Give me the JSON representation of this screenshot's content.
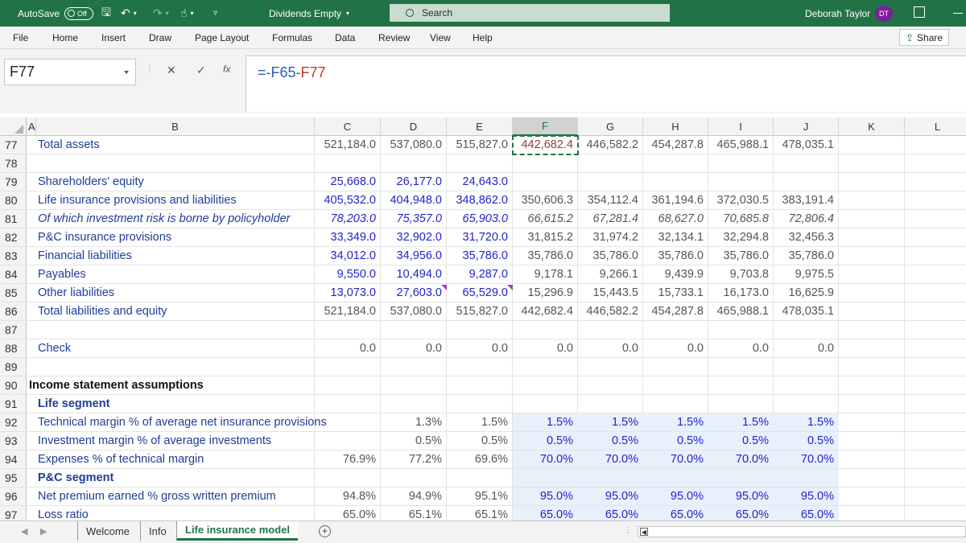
{
  "titlebar": {
    "autosave_label": "AutoSave",
    "autosave_state": "Off",
    "doc_title": "Dividends Empty",
    "search_placeholder": "Search",
    "user_name": "Deborah Taylor",
    "user_initials": "DT",
    "accent_color": "#217346"
  },
  "menu": {
    "items": [
      "File",
      "Home",
      "Insert",
      "Draw",
      "Page Layout",
      "Formulas",
      "Data",
      "Review",
      "View",
      "Help"
    ],
    "share_label": "Share"
  },
  "formula_bar": {
    "name_box": "F77",
    "cancel_symbol": "✕",
    "enter_symbol": "✓",
    "fx_symbol": "fx",
    "formula_prefix": "=-",
    "formula_ref1": "F65",
    "formula_op": "-",
    "formula_ref2": "F77"
  },
  "columns": [
    "A",
    "B",
    "C",
    "D",
    "E",
    "F",
    "G",
    "H",
    "I",
    "J",
    "K",
    "L"
  ],
  "rows": [
    {
      "n": "77",
      "label": "Total assets",
      "style": "normal",
      "values": [
        "521,184.0",
        "537,080.0",
        "515,827.0",
        "442,682.4",
        "446,582.2",
        "454,287.8",
        "465,988.1",
        "478,035.1"
      ],
      "colors": [
        "gray",
        "gray",
        "gray",
        "gray",
        "gray",
        "gray",
        "gray",
        "gray"
      ]
    },
    {
      "n": "78",
      "label": "",
      "style": "normal",
      "values": [],
      "colors": []
    },
    {
      "n": "79",
      "label": "Shareholders' equity",
      "style": "normal",
      "values": [
        "25,668.0",
        "26,177.0",
        "24,643.0"
      ],
      "colors": [
        "blue",
        "blue",
        "blue"
      ]
    },
    {
      "n": "80",
      "label": "Life insurance provisions and liabilities",
      "style": "normal",
      "values": [
        "405,532.0",
        "404,948.0",
        "348,862.0",
        "350,606.3",
        "354,112.4",
        "361,194.6",
        "372,030.5",
        "383,191.4"
      ],
      "colors": [
        "blue",
        "blue",
        "blue",
        "gray",
        "gray",
        "gray",
        "gray",
        "gray"
      ]
    },
    {
      "n": "81",
      "label": "Of which investment risk is borne by policyholder",
      "style": "italic",
      "values": [
        "78,203.0",
        "75,357.0",
        "65,903.0",
        "66,615.2",
        "67,281.4",
        "68,627.0",
        "70,685.8",
        "72,806.4"
      ],
      "colors": [
        "blue",
        "blue",
        "blue",
        "gray",
        "gray",
        "gray",
        "gray",
        "gray"
      ]
    },
    {
      "n": "82",
      "label": "P&C insurance provisions",
      "style": "normal",
      "values": [
        "33,349.0",
        "32,902.0",
        "31,720.0",
        "31,815.2",
        "31,974.2",
        "32,134.1",
        "32,294.8",
        "32,456.3"
      ],
      "colors": [
        "blue",
        "blue",
        "blue",
        "gray",
        "gray",
        "gray",
        "gray",
        "gray"
      ]
    },
    {
      "n": "83",
      "label": "Financial liabilities",
      "style": "normal",
      "values": [
        "34,012.0",
        "34,956.0",
        "35,786.0",
        "35,786.0",
        "35,786.0",
        "35,786.0",
        "35,786.0",
        "35,786.0"
      ],
      "colors": [
        "blue",
        "blue",
        "blue",
        "gray",
        "gray",
        "gray",
        "gray",
        "gray"
      ]
    },
    {
      "n": "84",
      "label": "Payables",
      "style": "normal",
      "values": [
        "9,550.0",
        "10,494.0",
        "9,287.0",
        "9,178.1",
        "9,266.1",
        "9,439.9",
        "9,703.8",
        "9,975.5"
      ],
      "colors": [
        "blue",
        "blue",
        "blue",
        "gray",
        "gray",
        "gray",
        "gray",
        "gray"
      ]
    },
    {
      "n": "85",
      "label": "Other liabilities",
      "style": "normal",
      "values": [
        "13,073.0",
        "27,603.0",
        "65,529.0",
        "15,296.9",
        "15,443.5",
        "15,733.1",
        "16,173.0",
        "16,625.9"
      ],
      "colors": [
        "blue",
        "blue",
        "blue",
        "gray",
        "gray",
        "gray",
        "gray",
        "gray"
      ]
    },
    {
      "n": "86",
      "label": "Total liabilities and equity",
      "style": "normal",
      "values": [
        "521,184.0",
        "537,080.0",
        "515,827.0",
        "442,682.4",
        "446,582.2",
        "454,287.8",
        "465,988.1",
        "478,035.1"
      ],
      "colors": [
        "gray",
        "gray",
        "gray",
        "gray",
        "gray",
        "gray",
        "gray",
        "gray"
      ]
    },
    {
      "n": "87",
      "label": "",
      "style": "normal",
      "values": [],
      "colors": []
    },
    {
      "n": "88",
      "label": "Check",
      "style": "normal",
      "values": [
        "0.0",
        "0.0",
        "0.0",
        "0.0",
        "0.0",
        "0.0",
        "0.0",
        "0.0"
      ],
      "colors": [
        "gray",
        "gray",
        "gray",
        "gray",
        "gray",
        "gray",
        "gray",
        "gray"
      ]
    },
    {
      "n": "89",
      "label": "",
      "style": "normal",
      "values": [],
      "colors": []
    },
    {
      "n": "90",
      "label": "Income statement assumptions",
      "style": "section",
      "values": [],
      "colors": []
    },
    {
      "n": "91",
      "label": "Life segment",
      "style": "sub",
      "values": [],
      "colors": []
    },
    {
      "n": "92",
      "label": "Technical margin % of average net insurance provisions",
      "style": "normal",
      "values": [
        "",
        "1.3%",
        "1.5%",
        "1.5%",
        "1.5%",
        "1.5%",
        "1.5%",
        "1.5%"
      ],
      "colors": [
        "gray",
        "gray",
        "gray",
        "blue",
        "blue",
        "blue",
        "blue",
        "blue"
      ]
    },
    {
      "n": "93",
      "label": "Investment margin % of average investments",
      "style": "normal",
      "values": [
        "",
        "0.5%",
        "0.5%",
        "0.5%",
        "0.5%",
        "0.5%",
        "0.5%",
        "0.5%"
      ],
      "colors": [
        "gray",
        "gray",
        "gray",
        "blue",
        "blue",
        "blue",
        "blue",
        "blue"
      ]
    },
    {
      "n": "94",
      "label": "Expenses % of technical margin",
      "style": "normal",
      "values": [
        "76.9%",
        "77.2%",
        "69.6%",
        "70.0%",
        "70.0%",
        "70.0%",
        "70.0%",
        "70.0%"
      ],
      "colors": [
        "gray",
        "gray",
        "gray",
        "blue",
        "blue",
        "blue",
        "blue",
        "blue"
      ]
    },
    {
      "n": "95",
      "label": "P&C segment",
      "style": "sub",
      "values": [],
      "colors": []
    },
    {
      "n": "96",
      "label": "Net premium earned % gross written premium",
      "style": "normal",
      "values": [
        "94.8%",
        "94.9%",
        "95.1%",
        "95.0%",
        "95.0%",
        "95.0%",
        "95.0%",
        "95.0%"
      ],
      "colors": [
        "gray",
        "gray",
        "gray",
        "blue",
        "blue",
        "blue",
        "blue",
        "blue"
      ]
    },
    {
      "n": "97",
      "label": "Loss ratio",
      "style": "normal",
      "values": [
        "65.0%",
        "65.1%",
        "65.1%",
        "65.0%",
        "65.0%",
        "65.0%",
        "65.0%",
        "65.0%"
      ],
      "colors": [
        "gray",
        "gray",
        "gray",
        "blue",
        "blue",
        "blue",
        "blue",
        "blue"
      ]
    }
  ],
  "sheets": {
    "tabs": [
      "Welcome",
      "Info",
      "Life insurance model"
    ],
    "active": "Life insurance model",
    "add_symbol": "+"
  }
}
